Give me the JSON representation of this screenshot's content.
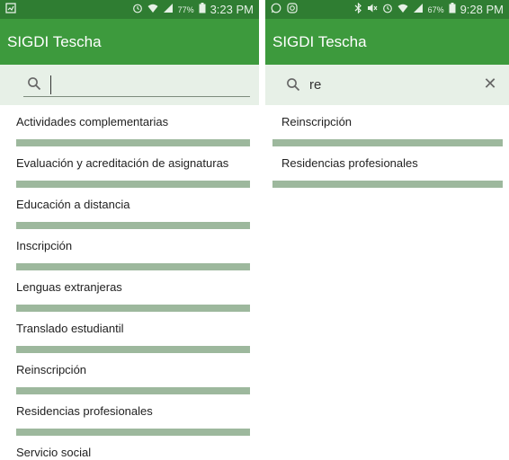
{
  "left": {
    "status": {
      "battery_percent": "77%",
      "time": "3:23 PM",
      "icons": [
        "notification-icon",
        "alarm-icon",
        "wifi-icon",
        "signal-icon",
        "battery-icon"
      ]
    },
    "app_title": "SIGDI Tescha",
    "search": {
      "value": "",
      "placeholder": ""
    },
    "items": [
      {
        "label": "Actividades complementarias"
      },
      {
        "label": "Evaluación y acreditación de asignaturas"
      },
      {
        "label": "Educación a distancia"
      },
      {
        "label": "Inscripción"
      },
      {
        "label": "Lenguas extranjeras"
      },
      {
        "label": "Translado estudiantil"
      },
      {
        "label": "Reinscripción"
      },
      {
        "label": "Residencias profesionales"
      },
      {
        "label": "Servicio social"
      }
    ]
  },
  "right": {
    "status": {
      "battery_percent": "67%",
      "time": "9:28 PM",
      "icons": [
        "whatsapp-icon",
        "instagram-icon",
        "bluetooth-icon",
        "mute-icon",
        "alarm-icon",
        "wifi-icon",
        "signal-icon",
        "battery-icon"
      ]
    },
    "app_title": "SIGDI Tescha",
    "search": {
      "value": "re",
      "clear_icon": "close-icon"
    },
    "items": [
      {
        "label": "Reinscripción"
      },
      {
        "label": "Residencias profesionales"
      }
    ]
  },
  "colors": {
    "status_bar": "#2f7d32",
    "app_bar": "#3d9a3d",
    "search_bg": "#e7f0e7",
    "divider": "#9db89d"
  }
}
